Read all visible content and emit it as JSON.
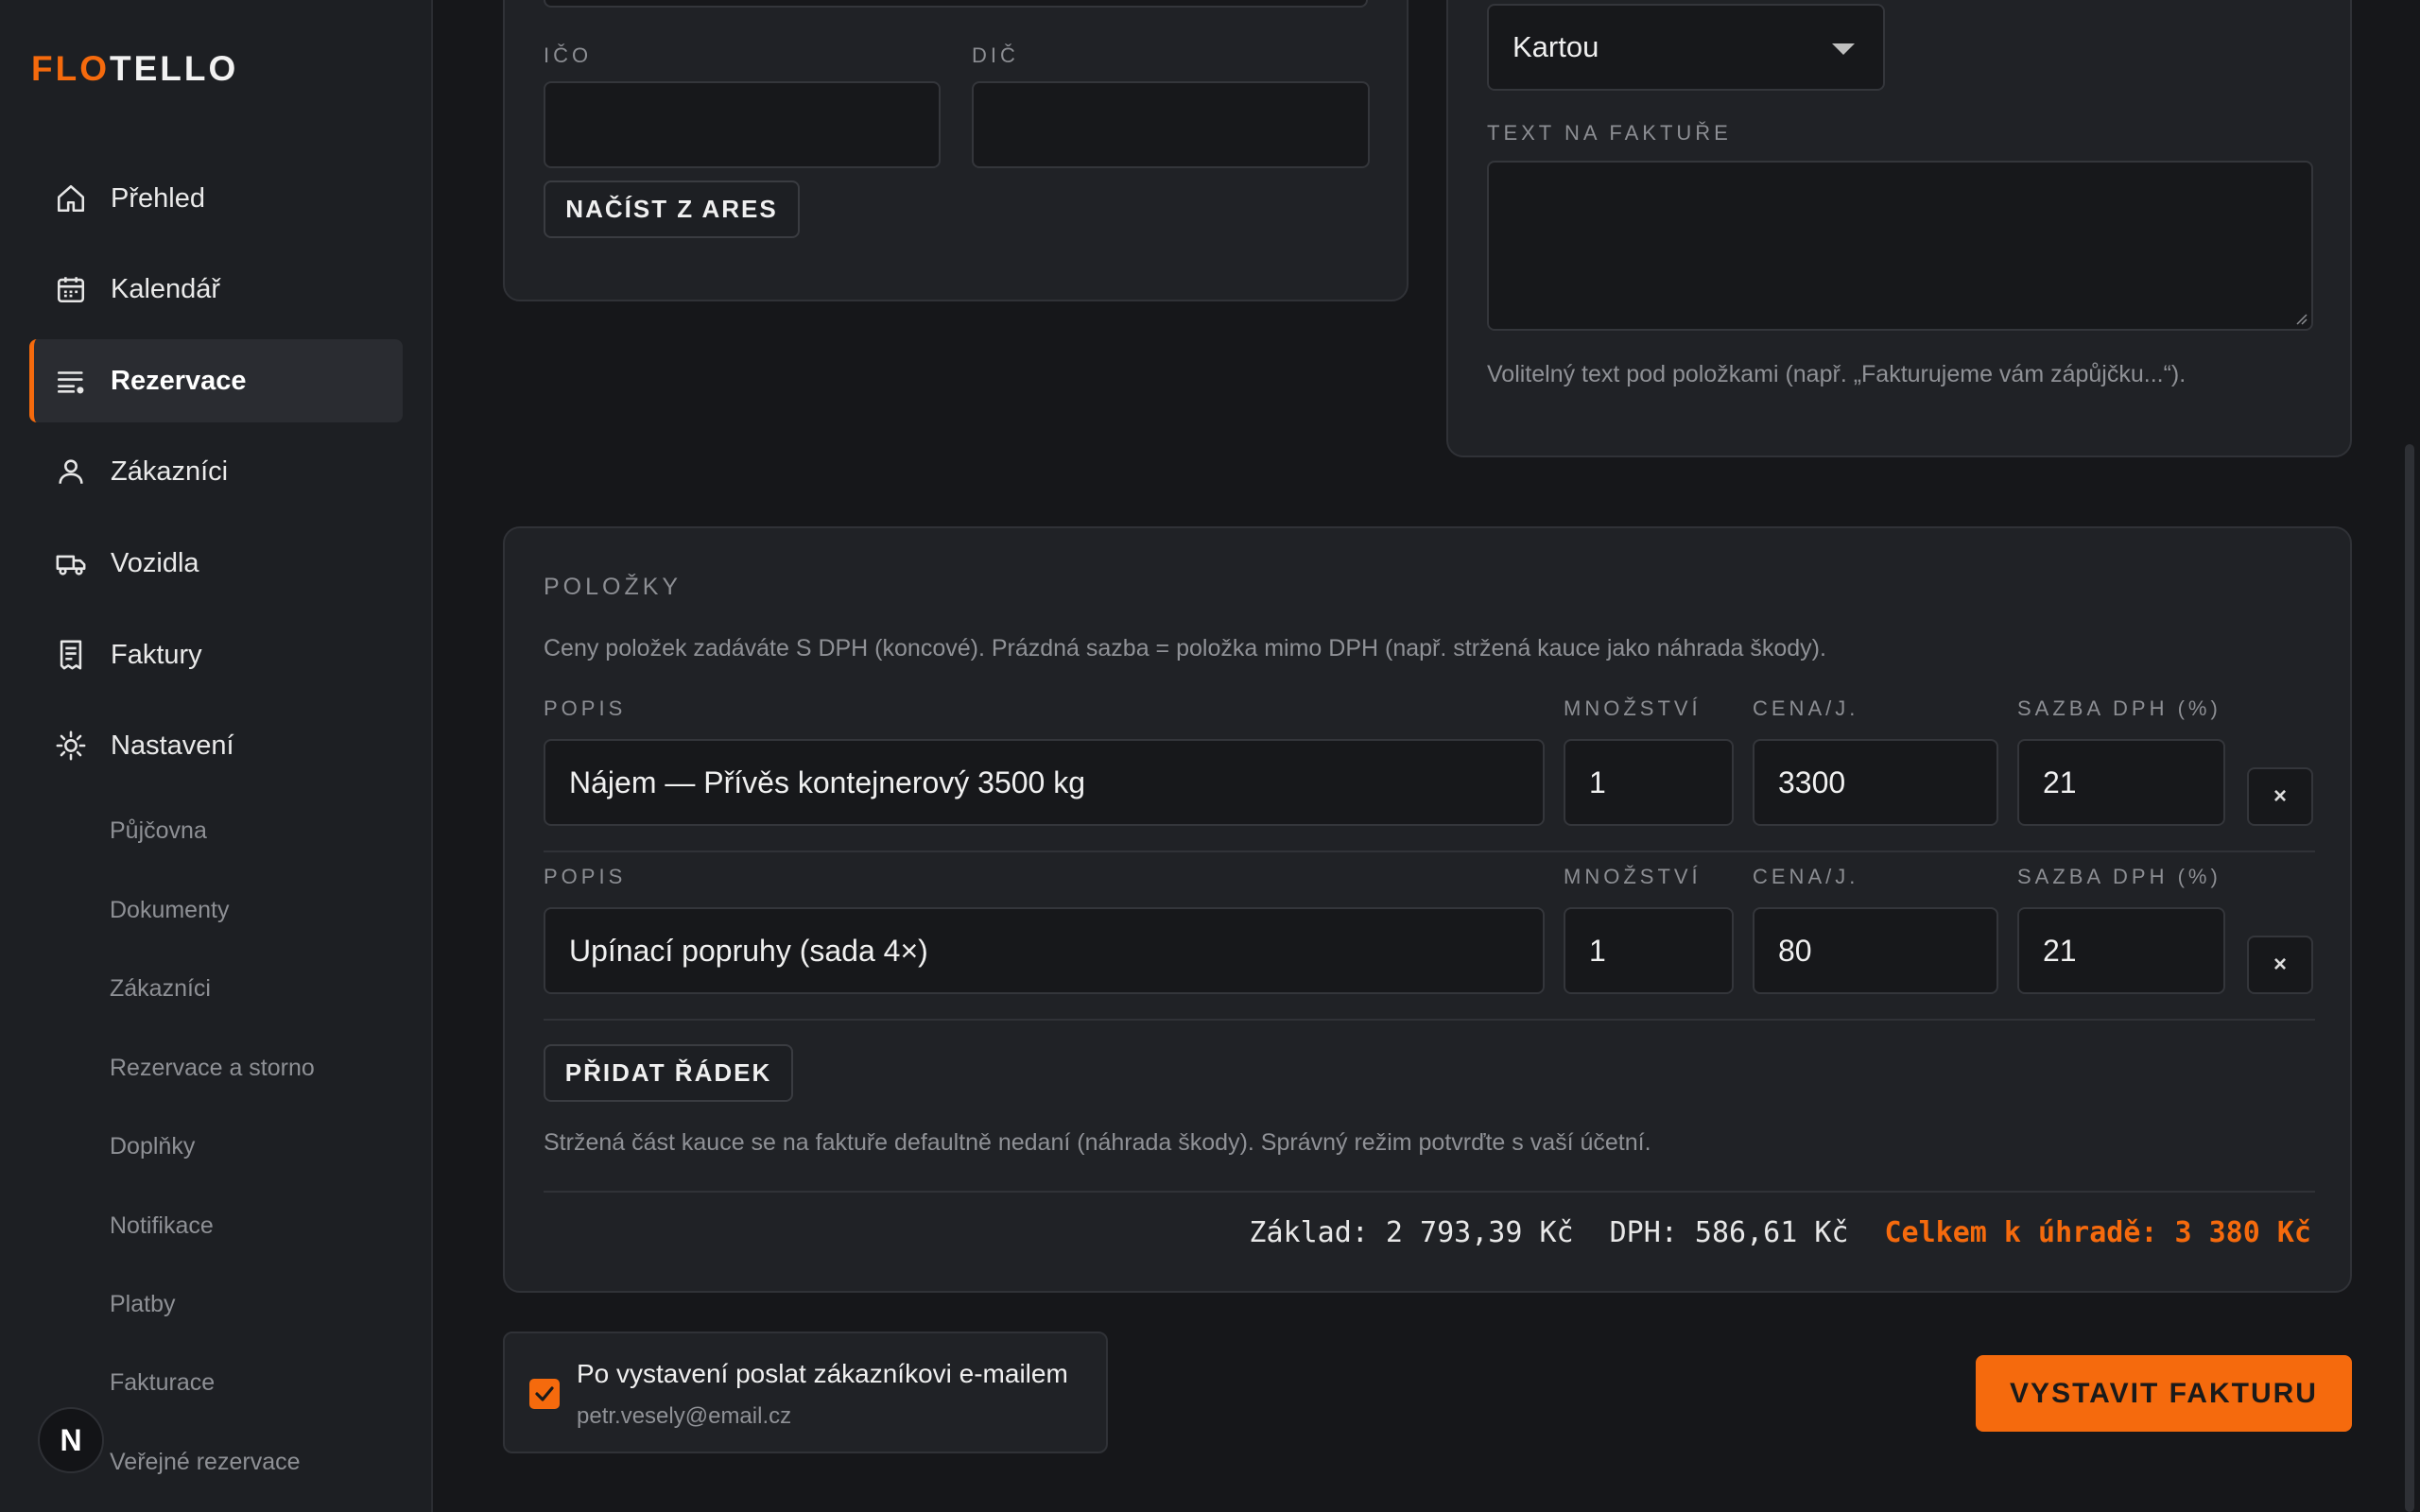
{
  "app": {
    "logo_a": "FLO",
    "logo_b": "TELLO",
    "avatar": "N"
  },
  "sidebar": {
    "nav": [
      {
        "label": "Přehled",
        "icon": "home-icon"
      },
      {
        "label": "Kalendář",
        "icon": "calendar-icon"
      },
      {
        "label": "Rezervace",
        "icon": "list-icon"
      },
      {
        "label": "Zákazníci",
        "icon": "user-icon"
      },
      {
        "label": "Vozidla",
        "icon": "truck-icon"
      },
      {
        "label": "Faktury",
        "icon": "receipt-icon"
      },
      {
        "label": "Nastavení",
        "icon": "gear-icon"
      }
    ],
    "active": "Rezervace",
    "sub": [
      "Půjčovna",
      "Dokumenty",
      "Zákazníci",
      "Rezervace a storno",
      "Doplňky",
      "Notifikace",
      "Platby",
      "Fakturace",
      "Veřejné rezervace"
    ]
  },
  "company": {
    "ico_label": "IČO",
    "dic_label": "DIČ",
    "ico_value": "",
    "dic_value": "",
    "ares_button": "NAČÍST Z ARES"
  },
  "payment": {
    "method": "Kartou",
    "text_label": "TEXT NA FAKTUŘE",
    "text_value": "",
    "text_help": "Volitelný text pod položkami (např. „Fakturujeme vám zápůjčku...“)."
  },
  "items": {
    "title": "POLOŽKY",
    "hint": "Ceny položek zadáváte S DPH (koncové). Prázdná sazba = položka mimo DPH (např. stržená kauce jako náhrada škody).",
    "col_desc": "POPIS",
    "col_qty": "MNOŽSTVÍ",
    "col_price": "CENA/J.",
    "col_vat": "SAZBA DPH (%)",
    "rows": [
      {
        "desc": "Nájem — Přívěs kontejnerový 3500 kg",
        "qty": "1",
        "price": "3300",
        "vat": "21"
      },
      {
        "desc": "Upínací popruhy (sada 4×)",
        "qty": "1",
        "price": "80",
        "vat": "21"
      }
    ],
    "remove_label": "×",
    "add_button": "PŘIDAT ŘÁDEK",
    "note": "Stržená část kauce se na faktuře defaultně nedaní (náhrada škody). Správný režim potvrďte s vaší účetní.",
    "base": "Základ: 2 793,39 Kč",
    "vat_total": "DPH: 586,61 Kč",
    "grand_total": "Celkem k úhradě: 3 380 Kč"
  },
  "email": {
    "checked": true,
    "label": "Po vystavení poslat zákazníkovi e-mailem",
    "address": "petr.vesely@email.cz"
  },
  "submit_button": "VYSTAVIT FAKTURU",
  "colors": {
    "accent": "#f56a0d",
    "bg": "#16171a",
    "card": "#202226"
  }
}
